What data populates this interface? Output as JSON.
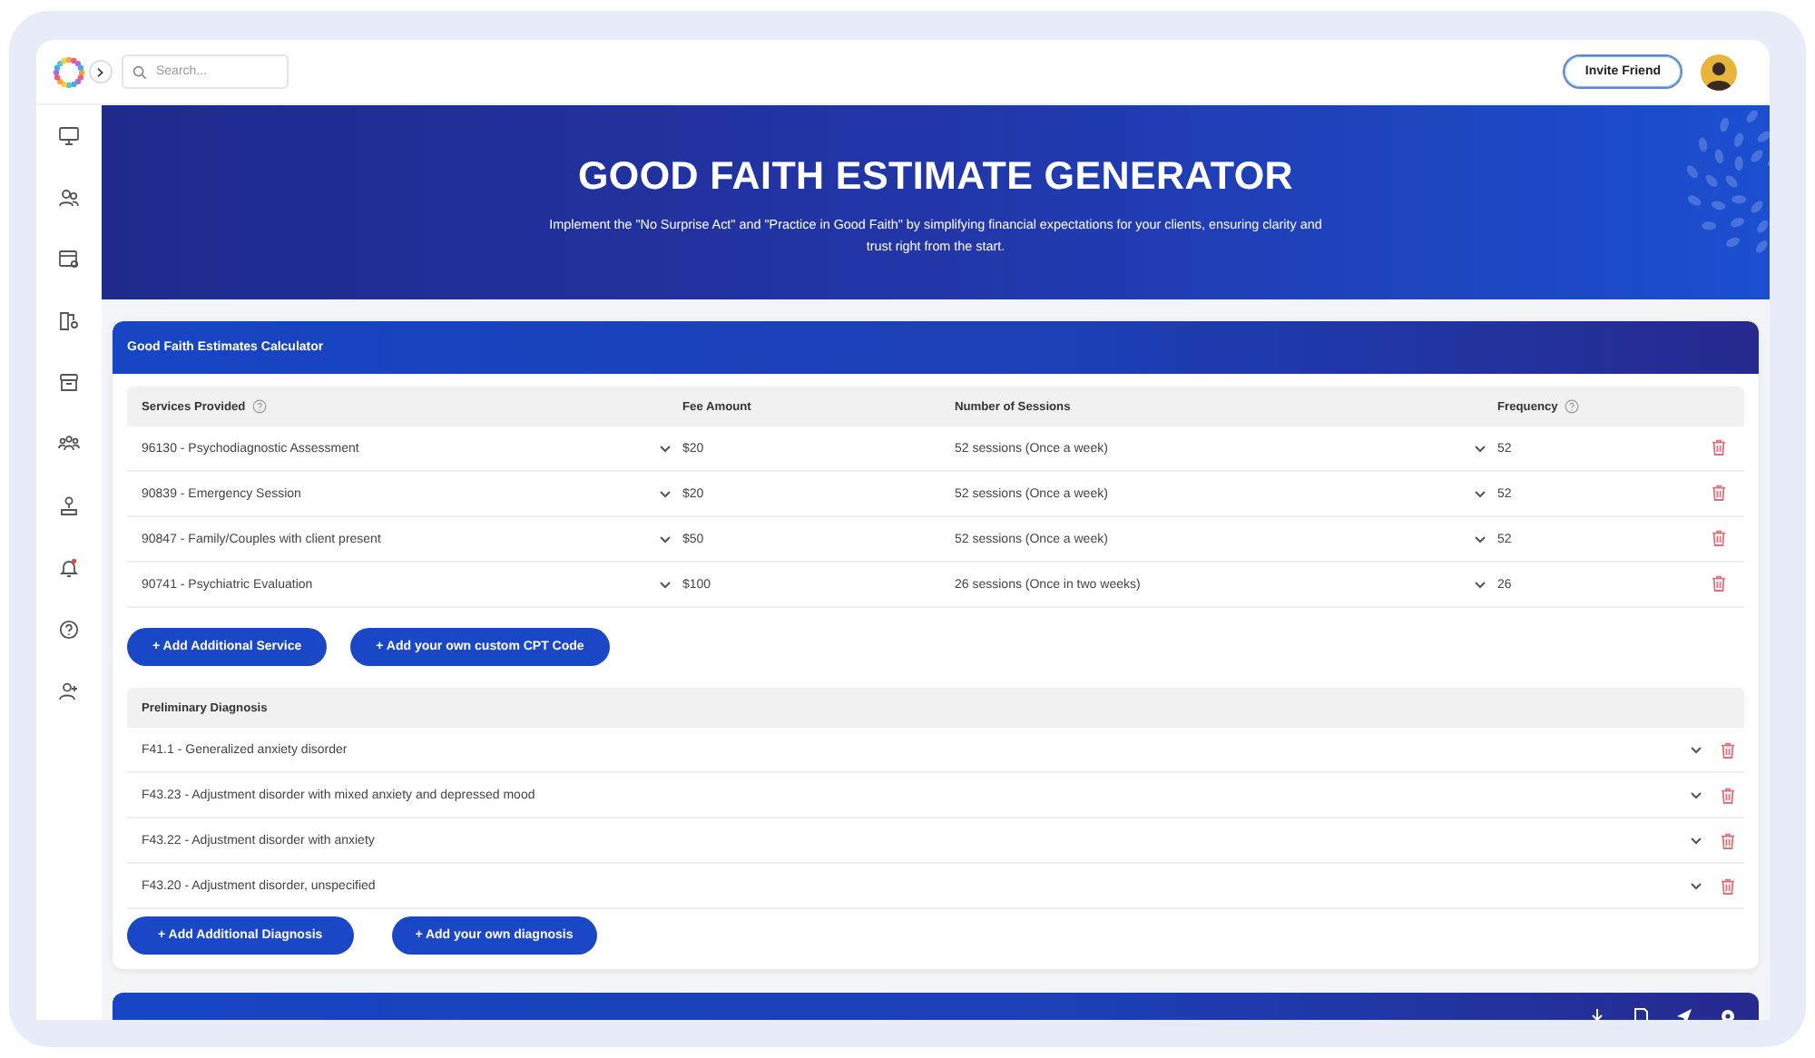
{
  "topbar": {
    "search": {
      "placeholder": "Search..."
    },
    "invite_button": "Invite Friend"
  },
  "banner": {
    "title": "GOOD FAITH ESTIMATE GENERATOR",
    "subtitle": "Implement the \"No Surprise Act\" and \"Practice in Good Faith\" by simplifying financial expectations for your clients, ensuring clarity and trust right from the start."
  },
  "calculator": {
    "title": "Good Faith Estimates Calculator",
    "columns": [
      {
        "label": "Services Provided",
        "help": true
      },
      {
        "label": "Fee Amount",
        "help": false
      },
      {
        "label": "Number of Sessions",
        "help": false
      },
      {
        "label": "Frequency",
        "help": true
      }
    ],
    "rows": [
      {
        "service": "96130 - Psychodiagnostic Assessment",
        "fee": "$20",
        "sessions": "52 sessions (Once a week)",
        "frequency": "52"
      },
      {
        "service": "90839 - Emergency Session",
        "fee": "$20",
        "sessions": "52 sessions (Once a week)",
        "frequency": "52"
      },
      {
        "service": "90847 - Family/Couples with client present",
        "fee": "$50",
        "sessions": "52 sessions (Once a week)",
        "frequency": "52"
      },
      {
        "service": "90741 - Psychiatric Evaluation",
        "fee": "$100",
        "sessions": "26 sessions (Once in two weeks)",
        "frequency": "26"
      }
    ],
    "service_buttons": [
      "+ Add Additional Service",
      "+ Add your own custom CPT Code"
    ],
    "diagnosis": {
      "title": "Preliminary Diagnosis",
      "rows": [
        "F41.1 - Generalized anxiety disorder",
        "F43.23 - Adjustment disorder with mixed anxiety and depressed mood",
        "F43.22 - Adjustment disorder with anxiety",
        "F43.20 - Adjustment disorder, unspecified"
      ],
      "buttons": [
        "+ Add Additional Diagnosis",
        "+ Add your own diagnosis"
      ]
    }
  }
}
